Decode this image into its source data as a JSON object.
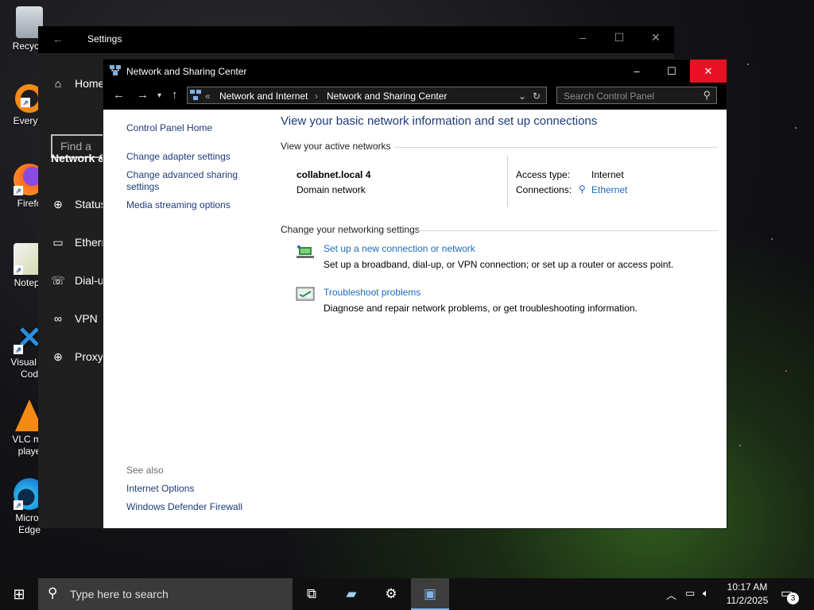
{
  "desktop": {
    "icons": [
      {
        "label": "Recycle",
        "icon": "recycle-bin-icon"
      },
      {
        "label": "Everyth",
        "icon": "everything-search-icon"
      },
      {
        "label": "Firefo",
        "icon": "firefox-icon"
      },
      {
        "label": "Notepa",
        "icon": "notepad-plus-plus-icon"
      },
      {
        "label": "Visual St",
        "label2": "Cod",
        "icon": "vscode-icon"
      },
      {
        "label": "VLC me",
        "label2": "playe",
        "icon": "vlc-icon"
      },
      {
        "label": "Micros",
        "label2": "Edge",
        "icon": "edge-icon"
      }
    ]
  },
  "settings_window": {
    "title": "Settings",
    "home": "Home",
    "find_placeholder": "Find a se",
    "section": "Network &",
    "items": [
      {
        "label": "Status",
        "icon": "globe-icon"
      },
      {
        "label": "Ethern",
        "icon": "ethernet-icon"
      },
      {
        "label": "Dial-u",
        "icon": "dialup-icon"
      },
      {
        "label": "VPN",
        "icon": "vpn-icon"
      },
      {
        "label": "Proxy",
        "icon": "globe-icon"
      }
    ]
  },
  "cp_window": {
    "title": "Network and Sharing Center",
    "breadcrumb": {
      "overflow": "«",
      "item1": "Network and Internet",
      "sep": "›",
      "item2": "Network and Sharing Center"
    },
    "search_placeholder": "Search Control Panel",
    "left_links": {
      "home": "Control Panel Home",
      "adapter": "Change adapter settings",
      "advanced_line1": "Change advanced sharing",
      "advanced_line2": "settings",
      "media": "Media streaming options"
    },
    "see_also": {
      "header": "See also",
      "internet_options": "Internet Options",
      "firewall": "Windows Defender Firewall"
    },
    "main": {
      "title": "View your basic network information and set up connections",
      "active_networks_header": "View your active networks",
      "network_name": "collabnet.local 4",
      "network_type": "Domain network",
      "access_type_label": "Access type:",
      "access_type_value": "Internet",
      "connections_label": "Connections:",
      "connections_value": "Ethernet",
      "change_settings_header": "Change your networking settings",
      "tasks": [
        {
          "link": "Set up a new connection or network",
          "desc": "Set up a broadband, dial-up, or VPN connection; or set up a router or access point."
        },
        {
          "link": "Troubleshoot problems",
          "desc": "Diagnose and repair network problems, or get troubleshooting information."
        }
      ]
    }
  },
  "taskbar": {
    "search_placeholder": "Type here to search",
    "time": "10:17 AM",
    "date": "11/2/2025",
    "notifications": "3"
  }
}
